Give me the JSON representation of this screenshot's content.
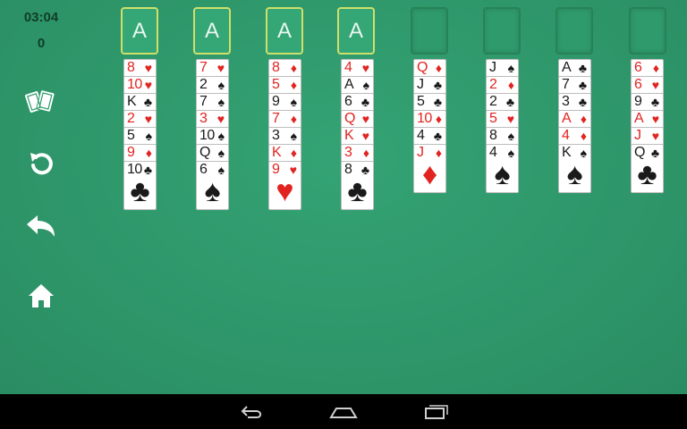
{
  "hud": {
    "time": "03:04",
    "moves": "0"
  },
  "side_buttons": [
    {
      "name": "new-deal-button",
      "icon": "cards-icon"
    },
    {
      "name": "restart-button",
      "icon": "restart-icon"
    },
    {
      "name": "undo-button",
      "icon": "undo-icon"
    },
    {
      "name": "home-button",
      "icon": "home-icon"
    }
  ],
  "foundations": [
    {
      "label": "A"
    },
    {
      "label": "A"
    },
    {
      "label": "A"
    },
    {
      "label": "A"
    }
  ],
  "free_cells": 4,
  "colors": {
    "felt": "#2f9a6c",
    "foundation_border": "#cfe06a",
    "red_suit": "#e12420",
    "black_suit": "#1a1a1a"
  },
  "columns": [
    [
      {
        "rank": "8",
        "suit": "♥",
        "color": "red"
      },
      {
        "rank": "10",
        "suit": "♥",
        "color": "red"
      },
      {
        "rank": "K",
        "suit": "♣",
        "color": "black"
      },
      {
        "rank": "2",
        "suit": "♥",
        "color": "red"
      },
      {
        "rank": "5",
        "suit": "♠",
        "color": "black"
      },
      {
        "rank": "9",
        "suit": "♦",
        "color": "red"
      },
      {
        "rank": "10",
        "suit": "♣",
        "color": "black"
      }
    ],
    [
      {
        "rank": "7",
        "suit": "♥",
        "color": "red"
      },
      {
        "rank": "2",
        "suit": "♠",
        "color": "black"
      },
      {
        "rank": "7",
        "suit": "♠",
        "color": "black"
      },
      {
        "rank": "3",
        "suit": "♥",
        "color": "red"
      },
      {
        "rank": "10",
        "suit": "♠",
        "color": "black"
      },
      {
        "rank": "Q",
        "suit": "♠",
        "color": "black"
      },
      {
        "rank": "6",
        "suit": "♠",
        "color": "black"
      }
    ],
    [
      {
        "rank": "8",
        "suit": "♦",
        "color": "red"
      },
      {
        "rank": "5",
        "suit": "♦",
        "color": "red"
      },
      {
        "rank": "9",
        "suit": "♠",
        "color": "black"
      },
      {
        "rank": "7",
        "suit": "♦",
        "color": "red"
      },
      {
        "rank": "3",
        "suit": "♠",
        "color": "black"
      },
      {
        "rank": "K",
        "suit": "♦",
        "color": "red"
      },
      {
        "rank": "9",
        "suit": "♥",
        "color": "red"
      }
    ],
    [
      {
        "rank": "4",
        "suit": "♥",
        "color": "red"
      },
      {
        "rank": "A",
        "suit": "♠",
        "color": "black"
      },
      {
        "rank": "6",
        "suit": "♣",
        "color": "black"
      },
      {
        "rank": "Q",
        "suit": "♥",
        "color": "red"
      },
      {
        "rank": "K",
        "suit": "♥",
        "color": "red"
      },
      {
        "rank": "3",
        "suit": "♦",
        "color": "red"
      },
      {
        "rank": "8",
        "suit": "♣",
        "color": "black"
      }
    ],
    [
      {
        "rank": "Q",
        "suit": "♦",
        "color": "red"
      },
      {
        "rank": "J",
        "suit": "♣",
        "color": "black"
      },
      {
        "rank": "5",
        "suit": "♣",
        "color": "black"
      },
      {
        "rank": "10",
        "suit": "♦",
        "color": "red"
      },
      {
        "rank": "4",
        "suit": "♣",
        "color": "black"
      },
      {
        "rank": "J",
        "suit": "♦",
        "color": "red"
      }
    ],
    [
      {
        "rank": "J",
        "suit": "♠",
        "color": "black"
      },
      {
        "rank": "2",
        "suit": "♦",
        "color": "red"
      },
      {
        "rank": "2",
        "suit": "♣",
        "color": "black"
      },
      {
        "rank": "5",
        "suit": "♥",
        "color": "red"
      },
      {
        "rank": "8",
        "suit": "♠",
        "color": "black"
      },
      {
        "rank": "4",
        "suit": "♠",
        "color": "black"
      }
    ],
    [
      {
        "rank": "A",
        "suit": "♣",
        "color": "black"
      },
      {
        "rank": "7",
        "suit": "♣",
        "color": "black"
      },
      {
        "rank": "3",
        "suit": "♣",
        "color": "black"
      },
      {
        "rank": "A",
        "suit": "♦",
        "color": "red"
      },
      {
        "rank": "4",
        "suit": "♦",
        "color": "red"
      },
      {
        "rank": "K",
        "suit": "♠",
        "color": "black"
      }
    ],
    [
      {
        "rank": "6",
        "suit": "♦",
        "color": "red"
      },
      {
        "rank": "6",
        "suit": "♥",
        "color": "red"
      },
      {
        "rank": "9",
        "suit": "♣",
        "color": "black"
      },
      {
        "rank": "A",
        "suit": "♥",
        "color": "red"
      },
      {
        "rank": "J",
        "suit": "♥",
        "color": "red"
      },
      {
        "rank": "Q",
        "suit": "♣",
        "color": "black"
      }
    ]
  ],
  "navbar": [
    {
      "name": "back-nav-button",
      "icon": "back-arrow-icon"
    },
    {
      "name": "home-nav-button",
      "icon": "home-outline-icon"
    },
    {
      "name": "recents-nav-button",
      "icon": "recents-icon"
    }
  ]
}
